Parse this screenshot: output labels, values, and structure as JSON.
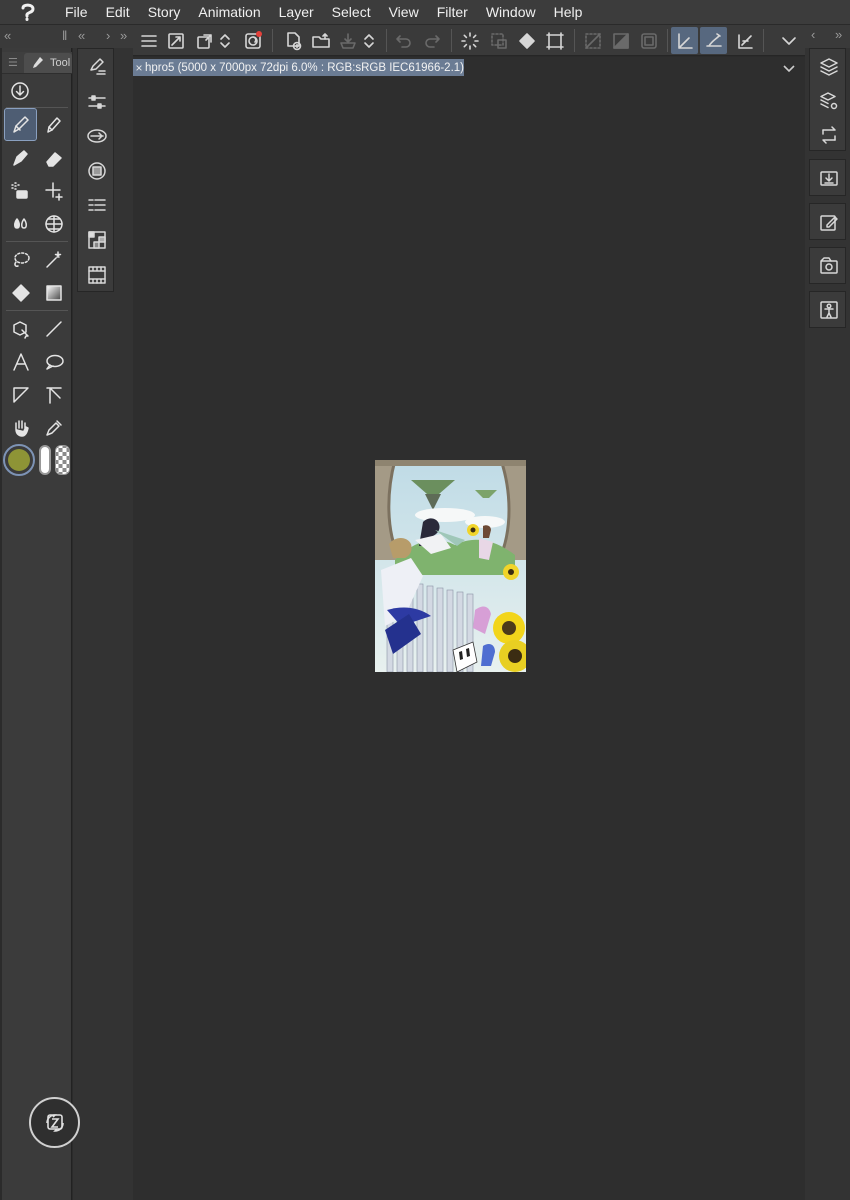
{
  "menubar": {
    "logo_icon": "clip-studio-logo-icon",
    "items": [
      "File",
      "Edit",
      "Story",
      "Animation",
      "Layer",
      "Select",
      "View",
      "Filter",
      "Window",
      "Help"
    ]
  },
  "left_panel": {
    "tab_label": "Tool",
    "header_left_glyph": "«",
    "header_mid_glyph": "‖",
    "header_right_glyph": "›",
    "header_far_glyph": "»",
    "sub_header_glyph": "«"
  },
  "right_panel": {
    "header_left_glyph": "‹",
    "header_right_glyph": "»"
  },
  "document": {
    "tab_label": "hpro5 (5000 x 7000px 72dpi 6.0% : RGB:sRGB IEC61966-2.1)",
    "close_glyph": "×"
  },
  "colors": {
    "main_color": "#8e9436",
    "sub_color": "#ffffff",
    "accent_active": "#57687f",
    "doc_tab": "#6b7c94"
  }
}
